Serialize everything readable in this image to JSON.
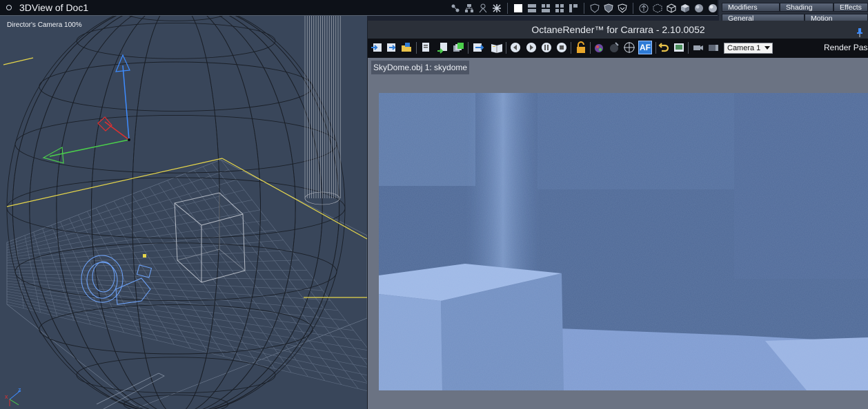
{
  "view3d": {
    "title": "3DView of Doc1",
    "camera_label": "Director's Camera 100%",
    "toolbar_icons": [
      "move-icon",
      "hierarchy-icon",
      "bones-icon",
      "magnet-icon",
      "single-view-icon",
      "two-views-icon",
      "three-views-icon",
      "four-views-icon",
      "split-view-icon",
      "shield-1-icon",
      "shield-2-icon",
      "shield-3-icon",
      "arrow-circle-icon",
      "cube-dashed-icon",
      "cube-wire-icon",
      "cube-solid-icon",
      "sphere-shaded-icon",
      "sphere-textured-icon"
    ]
  },
  "props": {
    "tabs": [
      "Modifiers",
      "Shading",
      "Effects",
      "General",
      "Motion"
    ]
  },
  "octane": {
    "title": "OctaneRender™ for Carrara - 2.10.0052",
    "camera_select": "Camera 1",
    "render_pass_label": "Render Pass",
    "status_label": "SkyDome.obj 1: skydome",
    "toolbar_icons": [
      "export-scene-icon",
      "export-alt-icon",
      "folder-icon",
      "copy-icon",
      "paste-icon",
      "layers-icon",
      "send-icon",
      "book-icon",
      "rewind-icon",
      "play-icon",
      "pause-icon",
      "stop-icon",
      "lock-icon",
      "material-icon",
      "pick-icon",
      "focus-icon",
      "autofocus-icon",
      "undo-icon",
      "image-icon",
      "camera-icon",
      "film-icon"
    ],
    "autofocus_text": "AF"
  },
  "colors": {
    "viewport_bg": "#39465a",
    "octane_bg": "#6b7383",
    "render_sky": "#4a6593",
    "highlight_yellow": "#e6d64a"
  }
}
